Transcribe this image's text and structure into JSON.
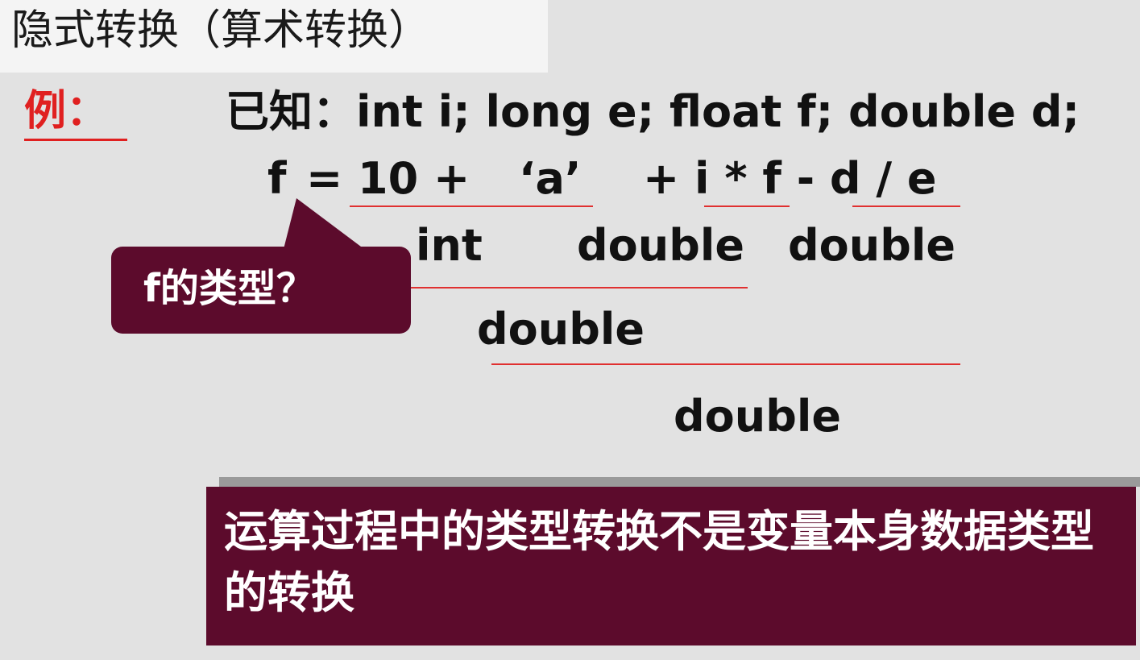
{
  "title": "隐式转换（算术转换）",
  "example_label": "例：",
  "known_decl": "已知：int i; long e; float f; double d;",
  "expression": {
    "lhs": "f",
    "eq": "=",
    "part1": "10 +",
    "part2": "‘a’",
    "part3": "+ i * f - d / e"
  },
  "types": {
    "int_label": "int",
    "mul_label": "double",
    "div_label": "double",
    "sum_label": "double",
    "final_label": "double"
  },
  "bubble_text": "f的类型？",
  "note_text": "运算过程中的类型转换不是变量本身数据类型的转换",
  "colors": {
    "accent": "#e02020",
    "callout_bg": "#5c0b2c",
    "page_bg": "#e2e2e2",
    "title_bg": "#f4f4f4"
  }
}
